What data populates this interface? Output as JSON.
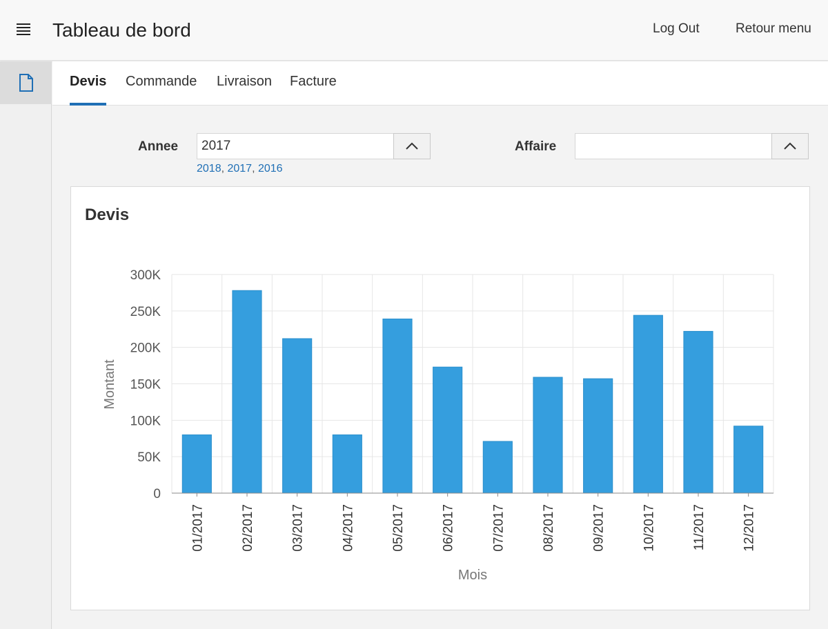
{
  "header": {
    "title": "Tableau de bord",
    "logout_label": "Log Out",
    "retour_label": "Retour menu"
  },
  "sidebar": {
    "items": [
      {
        "icon": "document-icon"
      }
    ]
  },
  "tabs": [
    {
      "label": "Devis",
      "active": true
    },
    {
      "label": "Commande",
      "active": false
    },
    {
      "label": "Livraison",
      "active": false
    },
    {
      "label": "Facture",
      "active": false
    }
  ],
  "filters": {
    "annee": {
      "label": "Annee",
      "value": "2017",
      "suggestions": [
        "2018",
        "2017",
        "2016"
      ],
      "separator": ", "
    },
    "affaire": {
      "label": "Affaire",
      "value": ""
    }
  },
  "colors": {
    "accent": "#1f6fb5",
    "bar": "#359ede",
    "grid": "#e6e6e6"
  },
  "card": {
    "title": "Devis"
  },
  "chart_data": {
    "type": "bar",
    "title": "Devis",
    "xlabel": "Mois",
    "ylabel": "Montant",
    "categories": [
      "01/2017",
      "02/2017",
      "03/2017",
      "04/2017",
      "05/2017",
      "06/2017",
      "07/2017",
      "08/2017",
      "09/2017",
      "10/2017",
      "11/2017",
      "12/2017"
    ],
    "values": [
      80000,
      278000,
      212000,
      80000,
      239000,
      173000,
      71000,
      159000,
      157000,
      244000,
      222000,
      92000
    ],
    "ylim": [
      0,
      300000
    ],
    "yticks": [
      0,
      50000,
      100000,
      150000,
      200000,
      250000,
      300000
    ],
    "ytick_labels": [
      "0",
      "50K",
      "100K",
      "150K",
      "200K",
      "250K",
      "300K"
    ],
    "grid": true,
    "legend": false
  }
}
